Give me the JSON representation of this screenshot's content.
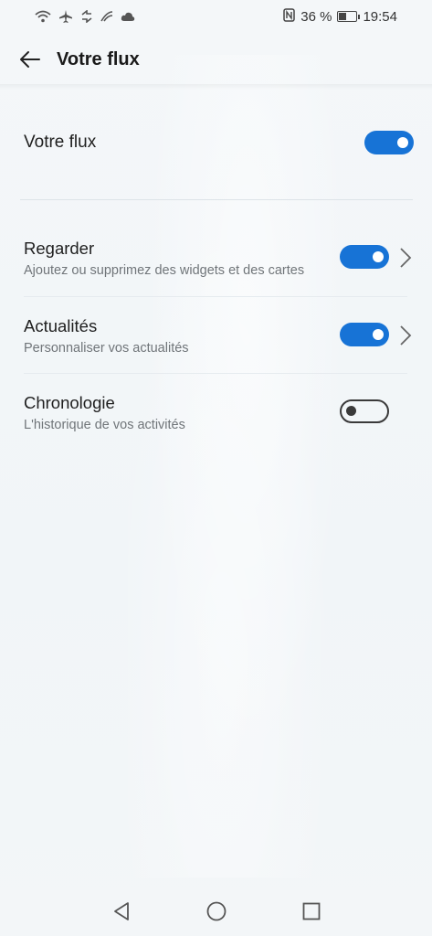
{
  "status_bar": {
    "battery_percent": "36 %",
    "time": "19:54"
  },
  "header": {
    "title": "Votre flux",
    "back_icon": "arrow-left-icon"
  },
  "main_toggle": {
    "label": "Votre flux",
    "enabled": true
  },
  "settings": [
    {
      "label": "Regarder",
      "subtitle": "Ajoutez ou supprimez des widgets et des cartes",
      "enabled": true,
      "has_chevron": true
    },
    {
      "label": "Actualités",
      "subtitle": "Personnaliser vos actualités",
      "enabled": true,
      "has_chevron": true
    },
    {
      "label": "Chronologie",
      "subtitle": "L'historique de vos activités",
      "enabled": false,
      "has_chevron": false
    }
  ],
  "colors": {
    "accent": "#1773d6",
    "background": "#f3f6f8",
    "subtitle": "#707579"
  }
}
